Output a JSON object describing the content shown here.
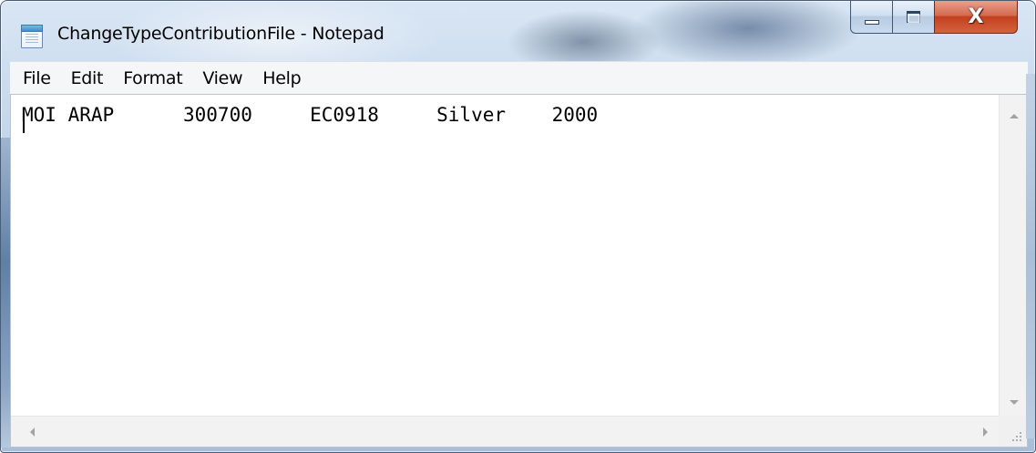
{
  "window": {
    "title": "ChangeTypeContributionFile - Notepad",
    "app_icon": "notepad-icon",
    "buttons": {
      "minimize": "minimize-icon",
      "maximize": "maximize-icon",
      "close_glyph": "X"
    }
  },
  "menu": {
    "items": [
      {
        "label": "File"
      },
      {
        "label": "Edit"
      },
      {
        "label": "Format"
      },
      {
        "label": "View"
      },
      {
        "label": "Help"
      }
    ]
  },
  "editor": {
    "content": "MOI ARAP      300700     EC0918     Silver    2000"
  },
  "colors": {
    "frame": "#c4d6ea",
    "close_button": "#c2401f",
    "editor_background": "#ffffff",
    "scrollbar": "#f2f2f2"
  }
}
